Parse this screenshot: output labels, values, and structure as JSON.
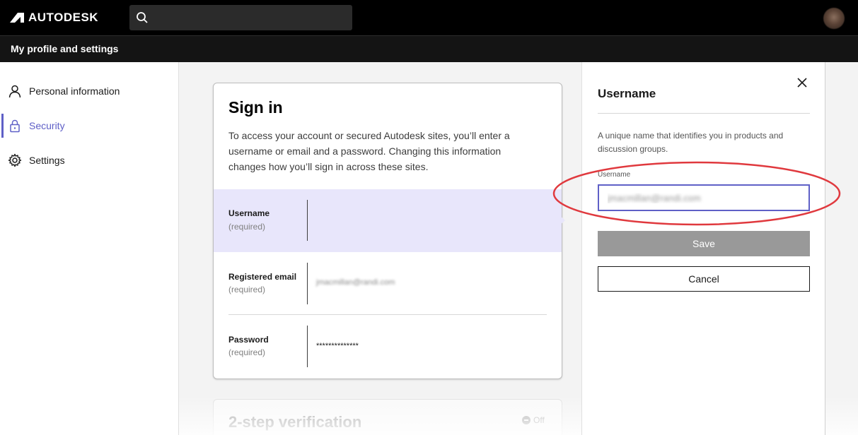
{
  "brand": {
    "name": "AUTODESK"
  },
  "search": {
    "placeholder": "",
    "icon": "search-icon"
  },
  "header": {
    "title": "My profile and settings"
  },
  "sidebar": {
    "items": [
      {
        "label": "Personal information",
        "icon": "person-icon",
        "active": false
      },
      {
        "label": "Security",
        "icon": "lock-icon",
        "active": true
      },
      {
        "label": "Settings",
        "icon": "gear-icon",
        "active": false
      }
    ]
  },
  "signin": {
    "title": "Sign in",
    "description": "To access your account or secured Autodesk sites, you’ll enter a username or email and a password. Changing this information changes how you’ll sign in across these sites.",
    "rows": [
      {
        "label": "Username",
        "required": "(required)",
        "value": ""
      },
      {
        "label": "Registered email",
        "required": "(required)",
        "value": "jmacmillan@randi.com"
      },
      {
        "label": "Password",
        "required": "(required)",
        "value": "**************"
      }
    ]
  },
  "twostep": {
    "title": "2-step verification",
    "status": "Off"
  },
  "panel": {
    "title": "Username",
    "description": "A unique name that identifies you in products and discussion groups.",
    "field_label": "Username",
    "field_value": "jmacmillan@randi.com",
    "save_label": "Save",
    "cancel_label": "Cancel"
  },
  "colors": {
    "accent": "#5f60c7",
    "selected_row": "#e8e6fb",
    "annotation": "#e0393e"
  }
}
